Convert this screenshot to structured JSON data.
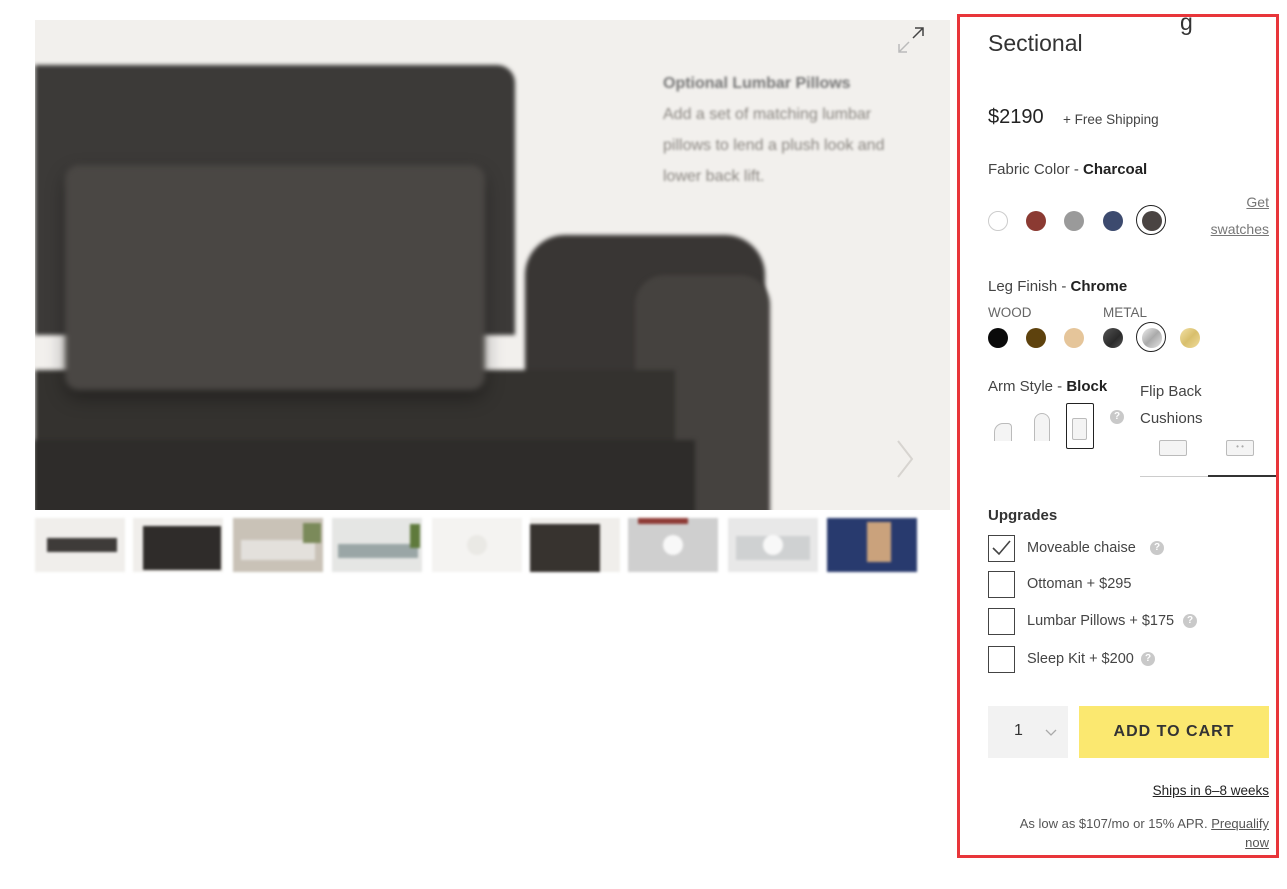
{
  "gallery": {
    "callout_title": "Optional Lumbar Pillows",
    "callout_text": "Add a set of matching lumbar pillows to lend a plush look and lower back lift.",
    "expand_icon": "expand-icon",
    "next_icon": "chevron-right-icon"
  },
  "product": {
    "title": "Sectional",
    "price": "$2190",
    "shipping": "+ Free Shipping"
  },
  "fabric": {
    "label": "Fabric Color - ",
    "value": "Charcoal",
    "swatches": [
      {
        "name": "white",
        "color": "#ffffff"
      },
      {
        "name": "red",
        "color": "#8b3a32"
      },
      {
        "name": "grey",
        "color": "#9a9a9a"
      },
      {
        "name": "navy",
        "color": "#3c4a6e"
      },
      {
        "name": "charcoal",
        "color": "#4a4442",
        "selected": true
      }
    ],
    "get_swatches": "Get swatches"
  },
  "legs": {
    "label": "Leg Finish - ",
    "value": "Chrome",
    "wood_label": "WOOD",
    "metal_label": "METAL",
    "swatches": [
      {
        "name": "black",
        "color": "#0a0a0a"
      },
      {
        "name": "walnut",
        "color": "#5e420d"
      },
      {
        "name": "natural",
        "color": "#e5c59a"
      },
      {
        "name": "gunmetal",
        "color": "#3a3a3a"
      },
      {
        "name": "chrome",
        "color": "#c8c8c8",
        "selected": true
      },
      {
        "name": "brass",
        "color": "#e6cf86"
      }
    ]
  },
  "arm": {
    "label": "Arm Style - ",
    "value": "Block"
  },
  "cushions": {
    "label_line1": "Flip Back",
    "label_line2": "Cushions"
  },
  "upgrades": {
    "heading": "Upgrades",
    "items": [
      {
        "label": "Moveable chaise",
        "checked": true
      },
      {
        "label": "Ottoman + $295",
        "checked": false
      },
      {
        "label": "Lumbar Pillows + $175",
        "checked": false
      },
      {
        "label": "Sleep Kit + $200",
        "checked": false
      }
    ]
  },
  "purchase": {
    "quantity": "1",
    "add_to_cart": "ADD TO CART",
    "ships_in": "Ships in 6–8 weeks",
    "apr_text": "As low as $107/mo or 15% APR.",
    "prequalify_1": "Prequalify",
    "prequalify_2": "now"
  }
}
